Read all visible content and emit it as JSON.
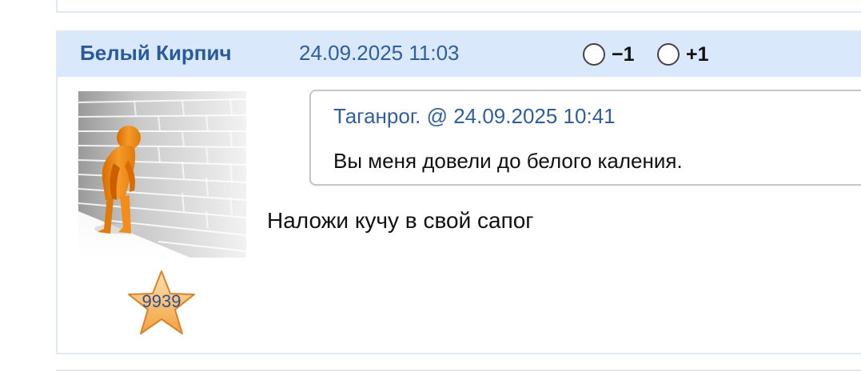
{
  "post": {
    "author": "Белый Кирпич",
    "datetime": "24.09.2025 11:03",
    "vote_minus_label": "−1",
    "vote_plus_label": "+1",
    "rating": "9939",
    "quote": {
      "source": "Таганрог. @ 24.09.2025 10:41",
      "text": "Вы меня довели до белого каления."
    },
    "text": "Наложи кучу в свой сапог"
  },
  "colors": {
    "header_bg": "#d9e8fa",
    "author": "#2a5a9a",
    "link": "#2f5f9f",
    "figure": "#f08a1c",
    "star": "#f6b95a"
  },
  "icons": {
    "avatar": "person-leaning-on-brick-wall",
    "rating": "star-icon"
  }
}
